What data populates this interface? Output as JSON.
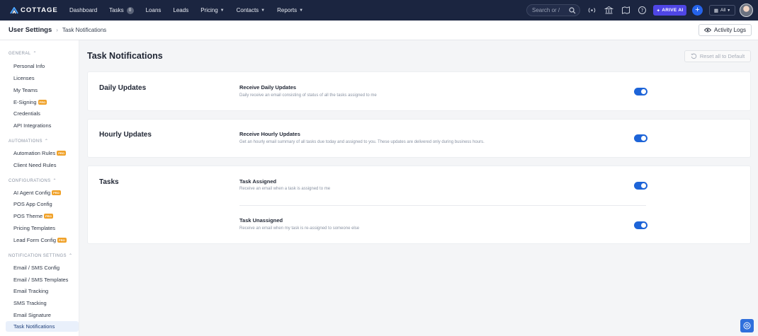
{
  "brand": {
    "name": "COTTAGE",
    "accent": "#1d64d8",
    "nav_bg": "#1b2540"
  },
  "nav": {
    "items": [
      {
        "label": "Dashboard",
        "badge": "",
        "dropdown": false
      },
      {
        "label": "Tasks",
        "badge": "0",
        "dropdown": false
      },
      {
        "label": "Loans",
        "badge": "",
        "dropdown": false
      },
      {
        "label": "Leads",
        "badge": "",
        "dropdown": false
      },
      {
        "label": "Pricing",
        "badge": "",
        "dropdown": true
      },
      {
        "label": "Contacts",
        "badge": "",
        "dropdown": true
      },
      {
        "label": "Reports",
        "badge": "",
        "dropdown": true
      }
    ],
    "search_placeholder": "Search or /",
    "icons": [
      "broadcast-icon",
      "bank-icon",
      "map-icon",
      "help-icon"
    ],
    "ai_button": "ARIVE AI",
    "plus": "+",
    "scope_select": "All"
  },
  "header": {
    "breadcrumb_main": "User Settings",
    "breadcrumb_sep": "›",
    "breadcrumb_current": "Task Notifications",
    "activity_logs": "Activity Logs"
  },
  "sidebar": {
    "sections": [
      {
        "title": "GENERAL",
        "items": [
          {
            "label": "Personal Info",
            "pro": false
          },
          {
            "label": "Licenses",
            "pro": false
          },
          {
            "label": "My Teams",
            "pro": false
          },
          {
            "label": "E-Signing",
            "pro": true
          },
          {
            "label": "Credentials",
            "pro": false
          },
          {
            "label": "API Integrations",
            "pro": false
          }
        ]
      },
      {
        "title": "AUTOMATIONS",
        "items": [
          {
            "label": "Automation Rules",
            "pro": true
          },
          {
            "label": "Client Need Rules",
            "pro": false
          }
        ]
      },
      {
        "title": "CONFIGURATIONS",
        "items": [
          {
            "label": "AI Agent Config",
            "pro": true
          },
          {
            "label": "POS App Config",
            "pro": false
          },
          {
            "label": "POS Theme",
            "pro": true
          },
          {
            "label": "Pricing Templates",
            "pro": false
          },
          {
            "label": "Lead Form Config",
            "pro": true
          }
        ]
      },
      {
        "title": "NOTIFICATION SETTINGS",
        "items": [
          {
            "label": "Email / SMS Config",
            "pro": false
          },
          {
            "label": "Email / SMS Templates",
            "pro": false
          },
          {
            "label": "Email Tracking",
            "pro": false
          },
          {
            "label": "SMS Tracking",
            "pro": false
          },
          {
            "label": "Email Signature",
            "pro": false
          },
          {
            "label": "Task Notifications",
            "pro": false,
            "active": true
          }
        ]
      }
    ],
    "pro_label": "PRO"
  },
  "main": {
    "title": "Task Notifications",
    "reset_label": "Reset all to Default",
    "cards": [
      {
        "title": "Daily Updates",
        "settings": [
          {
            "title": "Receive Daily Updates",
            "desc": "Daily receive an email consisting of status of all the tasks assigned to me",
            "on": true
          }
        ]
      },
      {
        "title": "Hourly Updates",
        "settings": [
          {
            "title": "Receive Hourly Updates",
            "desc": "Get an hourly email summary of all tasks due today and assigned to you. These updates are delivered only during business hours.",
            "on": true
          }
        ]
      },
      {
        "title": "Tasks",
        "settings": [
          {
            "title": "Task Assigned",
            "desc": "Receive an email when a task is assigned to me",
            "on": true
          },
          {
            "title": "Task Unassigned",
            "desc": "Receive an email when my task is re-assigned to someone else",
            "on": true
          }
        ]
      }
    ]
  }
}
